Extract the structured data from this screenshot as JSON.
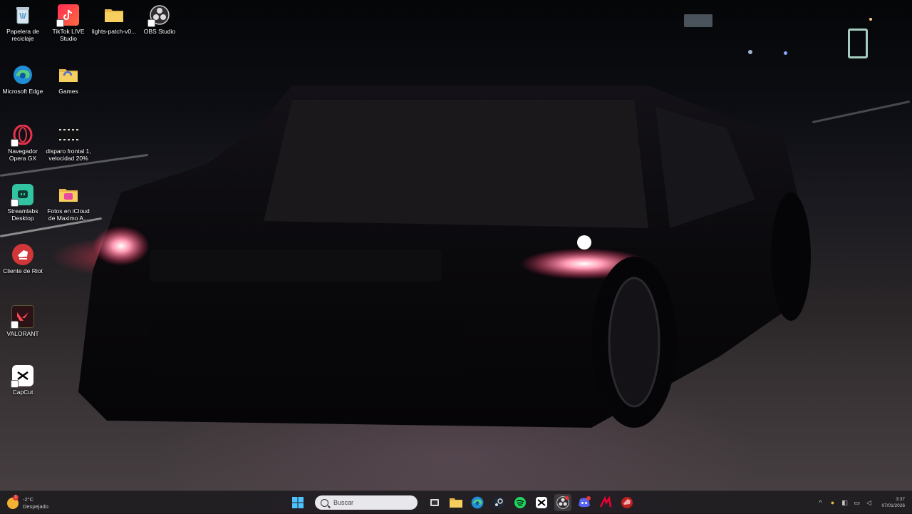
{
  "desktop": {
    "icons": [
      {
        "label": "Papelera de reciclaje",
        "icon": "recycle-bin-icon"
      },
      {
        "label": "TikTok LIVE Studio",
        "icon": "tiktok-live-icon"
      },
      {
        "label": "lights-patch-v0...",
        "icon": "folder-icon"
      },
      {
        "label": "OBS Studio",
        "icon": "obs-icon"
      },
      {
        "label": "Microsoft Edge",
        "icon": "edge-icon"
      },
      {
        "label": "Games",
        "icon": "folder-icon"
      },
      {
        "label": "Navegador Opera GX",
        "icon": "opera-gx-icon"
      },
      {
        "label": "disparo frontal 1, velocidad 20%",
        "icon": "video-file-icon"
      },
      {
        "label": "Streamlabs Desktop",
        "icon": "streamlabs-icon"
      },
      {
        "label": "Fotos en iCloud de Maximo A...",
        "icon": "folder-icon"
      },
      {
        "label": "Cliente de Riot",
        "icon": "riot-client-icon"
      },
      {
        "label": "VALORANT",
        "icon": "valorant-icon"
      },
      {
        "label": "CapCut",
        "icon": "capcut-icon"
      }
    ]
  },
  "taskbar": {
    "weather": {
      "temp": "-2°C",
      "condition": "Despejado",
      "alert_count": "1"
    },
    "search_placeholder": "Buscar",
    "apps": [
      "start-icon",
      "task-view-icon",
      "file-explorer-icon",
      "edge-icon",
      "steam-icon",
      "spotify-icon",
      "capcut-icon",
      "obs-icon",
      "discord-icon",
      "msi-afterburner-icon",
      "riot-client-icon"
    ],
    "clock": {
      "time": "3:37",
      "date": "07/01/2026"
    }
  },
  "colors": {
    "taskbar_bg": "#1c1a1e",
    "accent": "#0078d4",
    "headlight": "#ff3c6e"
  }
}
